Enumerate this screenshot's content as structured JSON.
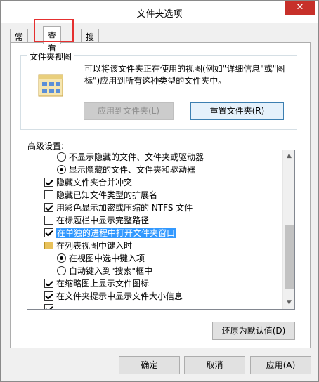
{
  "window": {
    "title": "文件夹选项",
    "close_glyph": "✕"
  },
  "tabs": [
    {
      "label": "常规",
      "active": false
    },
    {
      "label": "查看",
      "active": true
    },
    {
      "label": "搜索",
      "active": false
    }
  ],
  "folder_views": {
    "group_title": "文件夹视图",
    "description": "可以将该文件夹正在使用的视图(例如\"详细信息\"或\"图标\")应用到所有这种类型的文件夹中。",
    "apply_button": "应用到文件夹(L)",
    "reset_button": "重置文件夹(R)"
  },
  "advanced": {
    "label": "高级设置:",
    "items": [
      {
        "type": "radio",
        "checked": false,
        "label": "不显示隐藏的文件、文件夹或驱动器",
        "indent": 1
      },
      {
        "type": "radio",
        "checked": true,
        "label": "显示隐藏的文件、文件夹和驱动器",
        "indent": 1
      },
      {
        "type": "checkbox",
        "checked": true,
        "label": "隐藏文件夹合并冲突",
        "indent": 0
      },
      {
        "type": "checkbox",
        "checked": false,
        "label": "隐藏已知文件类型的扩展名",
        "indent": 0
      },
      {
        "type": "checkbox",
        "checked": true,
        "label": "用彩色显示加密或压缩的 NTFS 文件",
        "indent": 0
      },
      {
        "type": "checkbox",
        "checked": false,
        "label": "在标题栏中显示完整路径",
        "indent": 0
      },
      {
        "type": "checkbox",
        "checked": true,
        "label": "在单独的进程中打开文件夹窗口",
        "indent": 0,
        "selected": true
      },
      {
        "type": "folder",
        "checked": false,
        "label": "在列表视图中键入时",
        "indent": 0
      },
      {
        "type": "radio",
        "checked": true,
        "label": "在视图中选中键入项",
        "indent": 1
      },
      {
        "type": "radio",
        "checked": false,
        "label": "自动键入到\"搜索\"框中",
        "indent": 1
      },
      {
        "type": "checkbox",
        "checked": true,
        "label": "在缩略图上显示文件图标",
        "indent": 0
      },
      {
        "type": "checkbox",
        "checked": true,
        "label": "在文件夹提示中显示文件大小信息",
        "indent": 0
      },
      {
        "type": "checkbox",
        "checked": true,
        "label": "",
        "indent": 0
      }
    ],
    "restore_defaults": "还原为默认值(D)"
  },
  "footer": {
    "ok": "确定",
    "cancel": "取消",
    "apply": "应用(A)"
  },
  "colors": {
    "selection": "#3399ff",
    "highlight_box": "#e53030",
    "close_button": "#c7302a"
  }
}
